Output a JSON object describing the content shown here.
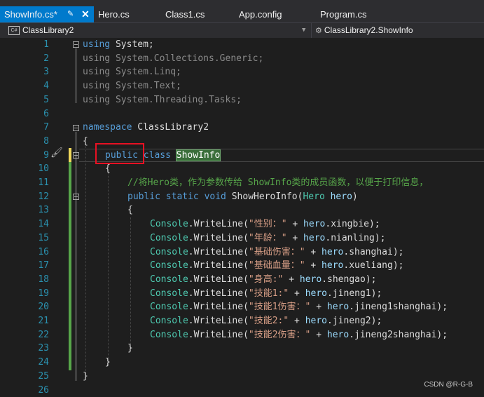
{
  "tabs": [
    {
      "label": "ShowInfo.cs*",
      "active": true
    },
    {
      "label": "Hero.cs"
    },
    {
      "label": "Class1.cs"
    },
    {
      "label": "App.config"
    },
    {
      "label": "Program.cs"
    }
  ],
  "tab_pin_icon": "pin-icon",
  "tab_close_icon": "close-icon",
  "navigation": {
    "project_icon_text": "C#",
    "project": "ClassLibrary2",
    "member": "ClassLibrary2.ShowInfo"
  },
  "line_numbers": [
    "1",
    "2",
    "3",
    "4",
    "5",
    "6",
    "7",
    "8",
    "9",
    "10",
    "11",
    "12",
    "13",
    "14",
    "15",
    "16",
    "17",
    "18",
    "19",
    "20",
    "21",
    "22",
    "23",
    "24",
    "25",
    "26"
  ],
  "code": {
    "l1_kw": "using",
    "l1_rest": " System;",
    "l2": "using System.Collections.Generic;",
    "l3": "using System.Linq;",
    "l4": "using System.Text;",
    "l5": "using System.Threading.Tasks;",
    "l7_kw": "namespace",
    "l7_rest": " ClassLibrary2",
    "l8": "{",
    "l9_kw1": "public",
    "l9_kw2": "class",
    "l9_cls": "ShowInfo",
    "l10": "{",
    "l11": "//将Hero类，作为参数传给 ShowInfo类的成员函数，以便于打印信息，",
    "l12_kw": "public static void",
    "l12_method": " ShowHeroInfo(",
    "l12_cls": "Hero",
    "l12_param": " hero",
    "l12_end": ")",
    "l13": "{",
    "writes": [
      {
        "str": "\"性别：\"",
        "field": "xingbie"
      },
      {
        "str": "\"年龄：\"",
        "field": "nianling"
      },
      {
        "str": "\"基础伤害：\"",
        "field": "shanghai"
      },
      {
        "str": "\"基础血量：\"",
        "field": "xueliang"
      },
      {
        "str": "\"身高:\"",
        "field": "shengao"
      },
      {
        "str": "\"技能1:\"",
        "field": "jineng1"
      },
      {
        "str": "\"技能1伤害：\"",
        "field": "jineng1shanghai"
      },
      {
        "str": "\"技能2:\"",
        "field": "jineng2"
      },
      {
        "str": "\"技能2伤害：\"",
        "field": "jineng2shanghai"
      }
    ],
    "console": "Console",
    "writeline": "WriteLine",
    "plus": " + ",
    "hero": "hero",
    "l23": "}",
    "l24": "}",
    "l25": "}"
  },
  "gutter_icon": "paintbrush-icon",
  "watermark": "CSDN @R-G-B",
  "colors": {
    "accent_tab": "#007acc",
    "keyword": "#569cd6",
    "type": "#4ec9b0",
    "string": "#d69d85",
    "comment": "#57a64a",
    "line_number": "#2b91af",
    "highlight_box": "#e81123"
  }
}
